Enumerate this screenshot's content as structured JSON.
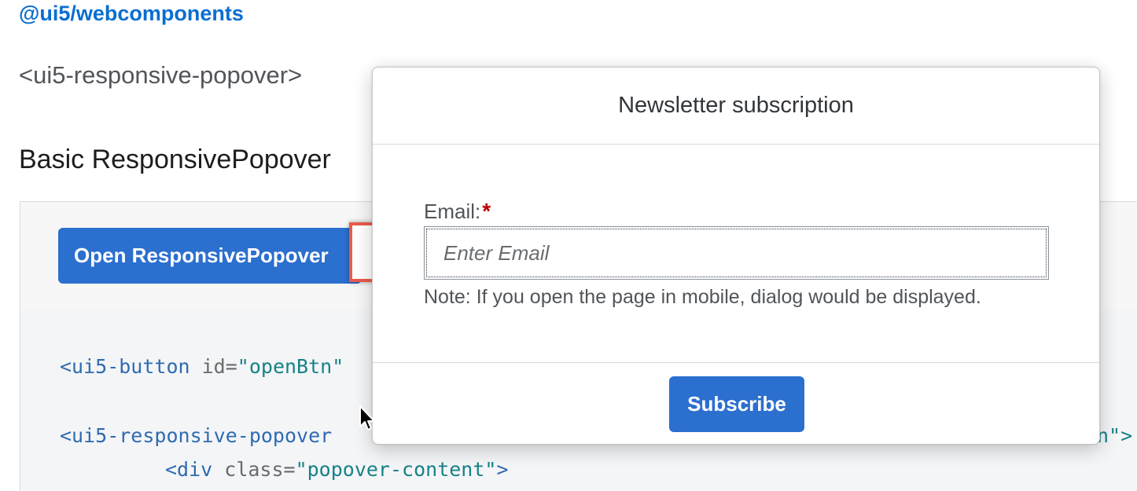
{
  "header": {
    "package_link": "@ui5/webcomponents",
    "tag_name": "<ui5-responsive-popover>",
    "section_title": "Basic ResponsivePopover"
  },
  "sample": {
    "open_button_label": "Open ResponsivePopover"
  },
  "code": {
    "line1": {
      "tag": "<ui5-button",
      "attr": " id=",
      "value": "\"openBtn\""
    },
    "line2": {
      "tag": "<ui5-responsive-popover",
      "tail": "n\">"
    },
    "line3": {
      "tag": "<div",
      "attr": " class=",
      "value": "\"popover-content\"",
      "close": ">"
    }
  },
  "popover": {
    "title": "Newsletter subscription",
    "email_label": "Email:",
    "required_mark": "*",
    "email_placeholder": "Enter Email",
    "email_value": "",
    "note": "Note: If you open the page in mobile, dialog would be displayed.",
    "subscribe_label": "Subscribe"
  },
  "colors": {
    "accent": "#2b6fcf",
    "link": "#0a6ed1",
    "highlight": "#e85b4c",
    "required": "#bb0000"
  },
  "icons": [
    "popover-arrow-icon",
    "mouse-pointer-icon"
  ]
}
